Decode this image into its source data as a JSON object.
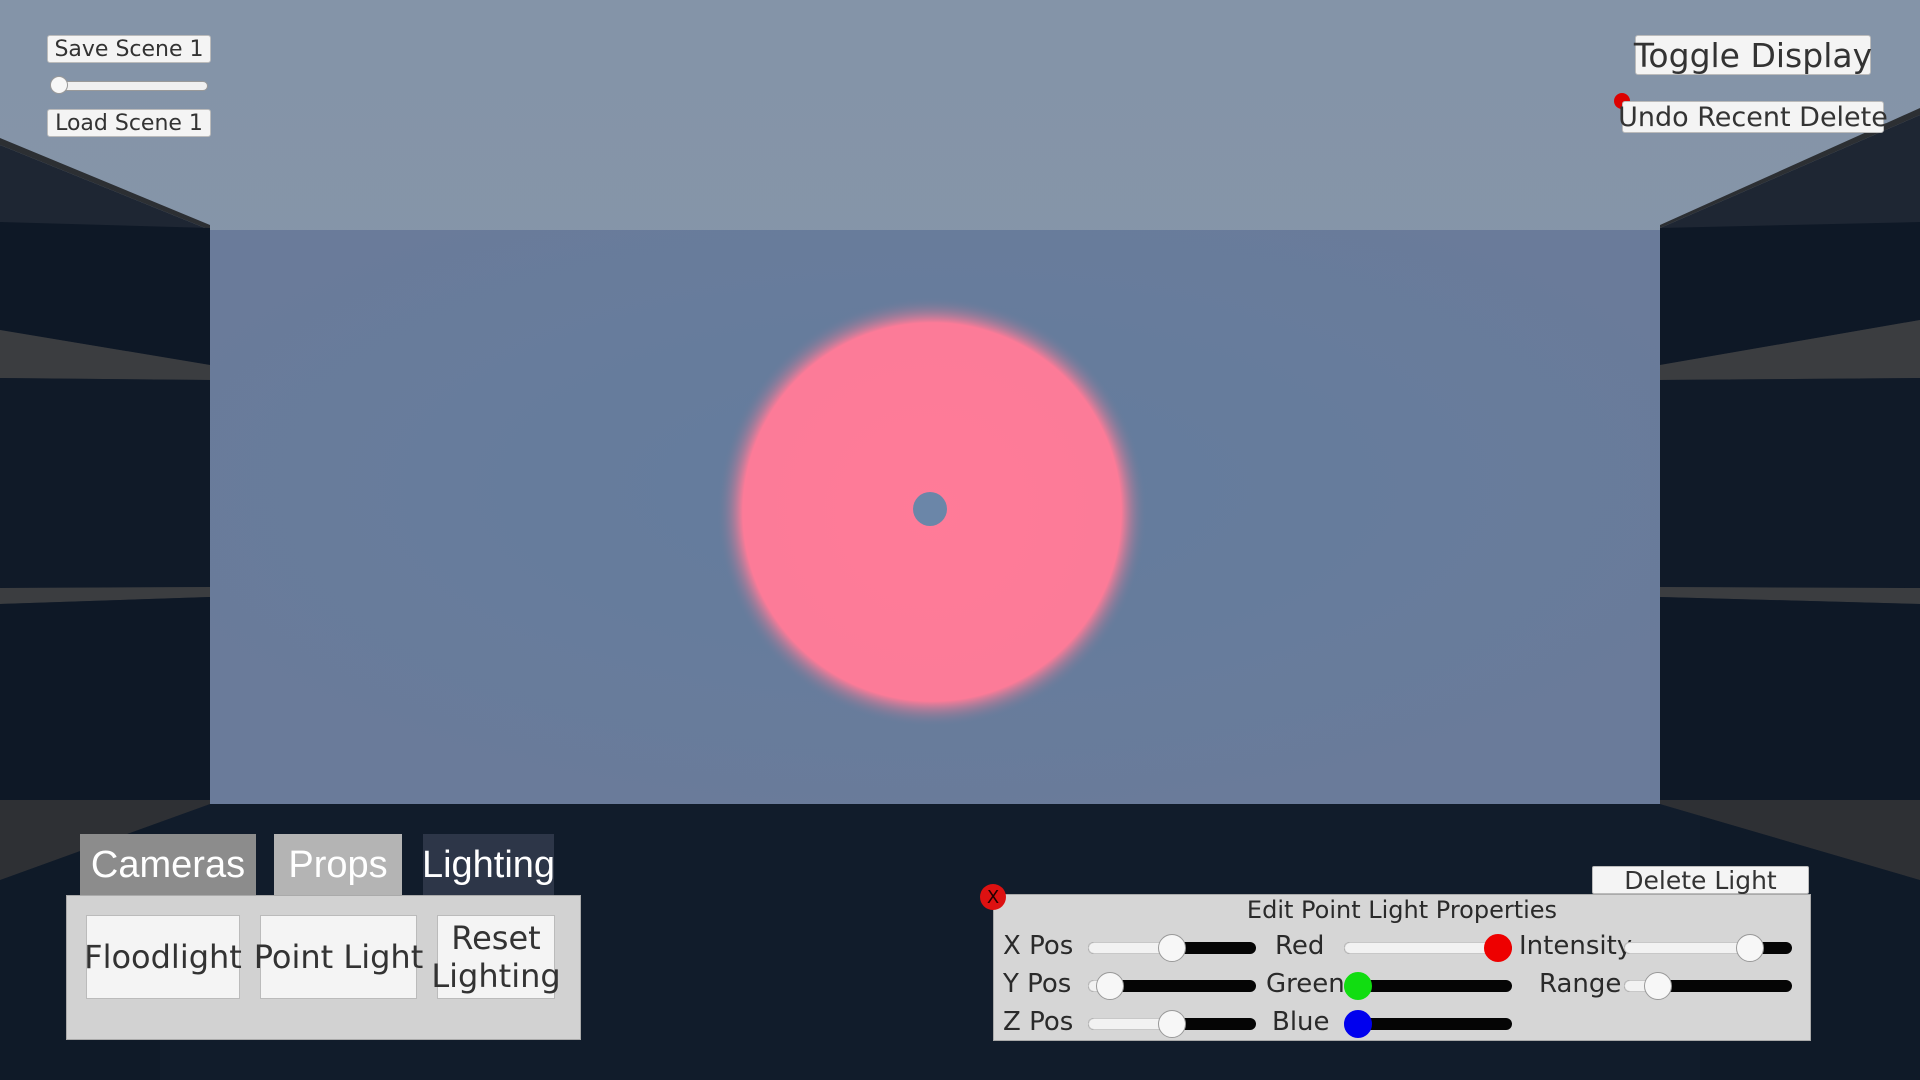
{
  "scene_menu": {
    "save_label": "Save Scene 1",
    "load_label": "Load Scene 1",
    "scene_slot": 0
  },
  "top_right": {
    "toggle_label": "Toggle Display",
    "undo_label": "Undo Recent Delete"
  },
  "tabs": [
    {
      "label": "Cameras",
      "color": "#8c8c8c"
    },
    {
      "label": "Props",
      "color": "#b4b4b4"
    },
    {
      "label": "Lighting",
      "color": "#2d3648"
    }
  ],
  "lighting_panel": {
    "buttons": [
      "Floodlight",
      "Point Light",
      "Reset\nLighting"
    ]
  },
  "light_editor": {
    "title": "Edit Point Light Properties",
    "close_glyph": "X",
    "delete_label": "Delete Light",
    "position": [
      {
        "label": "X Pos",
        "value": 0.5
      },
      {
        "label": "Y Pos",
        "value": 0.13
      },
      {
        "label": "Z Pos",
        "value": 0.5
      }
    ],
    "color": [
      {
        "label": "Red",
        "value": 1.0,
        "knob": "#ee0000"
      },
      {
        "label": "Green",
        "value": 0.08,
        "knob": "#11dd11"
      },
      {
        "label": "Blue",
        "value": 0.08,
        "knob": "#0000ee"
      }
    ],
    "other": [
      {
        "label": "Intensity",
        "value": 0.75
      },
      {
        "label": "Range",
        "value": 0.2
      }
    ]
  },
  "colors": {
    "sky": "#8796aa",
    "back_wall": "#6a7d9b",
    "light_glow": "#ff7b98",
    "floor": "#0f1a28"
  }
}
